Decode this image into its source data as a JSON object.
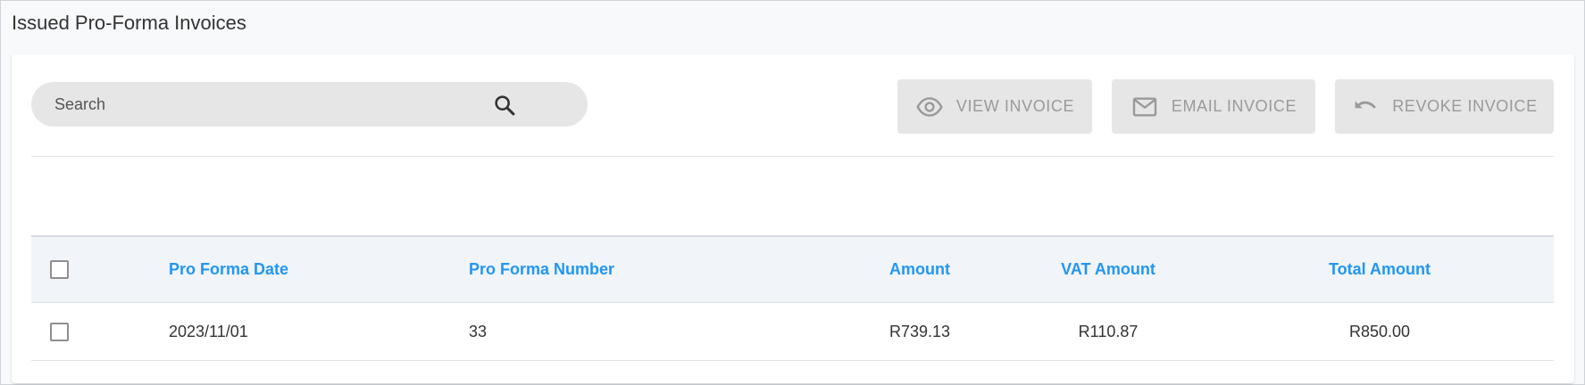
{
  "page": {
    "title": "Issued Pro-Forma Invoices"
  },
  "search": {
    "placeholder": "Search",
    "value": ""
  },
  "toolbar": {
    "view_label": "VIEW INVOICE",
    "email_label": "EMAIL INVOICE",
    "revoke_label": "REVOKE INVOICE",
    "disabled": true
  },
  "icons": {
    "search": "search-icon",
    "view": "eye-icon",
    "email": "envelope-icon",
    "revoke": "undo-icon"
  },
  "colors": {
    "header_text": "#2196f3",
    "button_bg": "#e6e6e6",
    "button_text": "#9a9a9a"
  },
  "table": {
    "columns": [
      "Pro Forma Date",
      "Pro Forma Number",
      "Amount",
      "VAT Amount",
      "Total Amount"
    ],
    "rows": [
      {
        "selected": false,
        "date": "2023/11/01",
        "number": "33",
        "amount": "R739.13",
        "vat": "R110.87",
        "total": "R850.00"
      }
    ]
  }
}
